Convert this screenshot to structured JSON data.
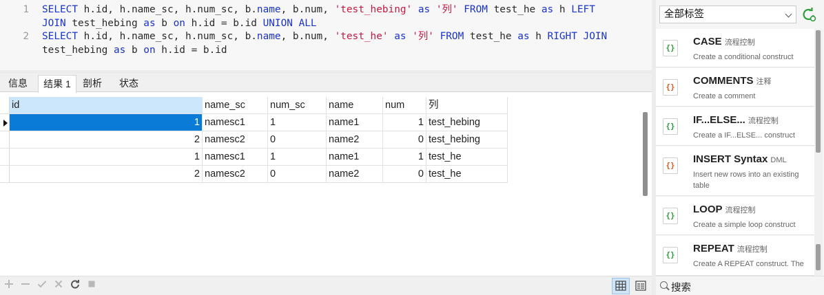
{
  "editor": {
    "lines": [
      {
        "number": "1",
        "tokens": [
          {
            "t": "SELECT ",
            "c": "kw"
          },
          {
            "t": "h.id, h.name_sc, h.num_sc, b.",
            "c": "id"
          },
          {
            "t": "name",
            "c": "kw"
          },
          {
            "t": ", b.num, ",
            "c": "id"
          },
          {
            "t": "'test_hebing'",
            "c": "str"
          },
          {
            "t": " as ",
            "c": "kw"
          },
          {
            "t": "'列'",
            "c": "str"
          },
          {
            "t": " FROM ",
            "c": "kw"
          },
          {
            "t": "test_he ",
            "c": "id"
          },
          {
            "t": "as",
            "c": "kw"
          },
          {
            "t": " h ",
            "c": "id"
          },
          {
            "t": "LEFT",
            "c": "kw"
          }
        ]
      },
      {
        "number": "",
        "tokens": [
          {
            "t": "JOIN",
            "c": "kw"
          },
          {
            "t": " test_hebing ",
            "c": "id"
          },
          {
            "t": "as",
            "c": "kw"
          },
          {
            "t": " b ",
            "c": "id"
          },
          {
            "t": "on",
            "c": "kw"
          },
          {
            "t": " h.id = b.id ",
            "c": "id"
          },
          {
            "t": "UNION ALL",
            "c": "kw"
          }
        ]
      },
      {
        "number": "2",
        "tokens": [
          {
            "t": "SELECT ",
            "c": "kw"
          },
          {
            "t": "h.id, h.name_sc, h.num_sc, b.",
            "c": "id"
          },
          {
            "t": "name",
            "c": "kw"
          },
          {
            "t": ", b.num, ",
            "c": "id"
          },
          {
            "t": "'test_he'",
            "c": "str"
          },
          {
            "t": " as ",
            "c": "kw"
          },
          {
            "t": "'列'",
            "c": "str"
          },
          {
            "t": " FROM ",
            "c": "kw"
          },
          {
            "t": "test_he ",
            "c": "id"
          },
          {
            "t": "as",
            "c": "kw"
          },
          {
            "t": " h ",
            "c": "id"
          },
          {
            "t": "RIGHT JOIN",
            "c": "kw"
          }
        ]
      },
      {
        "number": "",
        "tokens": [
          {
            "t": "test_hebing ",
            "c": "id"
          },
          {
            "t": "as",
            "c": "kw"
          },
          {
            "t": " b ",
            "c": "id"
          },
          {
            "t": "on",
            "c": "kw"
          },
          {
            "t": " h.id = b.id",
            "c": "id"
          }
        ]
      }
    ]
  },
  "tabs": [
    {
      "label": "信息",
      "active": false
    },
    {
      "label": "结果 1",
      "active": true
    },
    {
      "label": "剖析",
      "active": false
    },
    {
      "label": "状态",
      "active": false
    }
  ],
  "grid": {
    "columns": [
      "id",
      "name_sc",
      "num_sc",
      "name",
      "num",
      "列"
    ],
    "rows": [
      [
        "1",
        "namesc1",
        "1",
        "name1",
        "1",
        "test_hebing"
      ],
      [
        "2",
        "namesc2",
        "0",
        "name2",
        "0",
        "test_hebing"
      ],
      [
        "1",
        "namesc1",
        "1",
        "name1",
        "1",
        "test_he"
      ],
      [
        "2",
        "namesc2",
        "0",
        "name2",
        "0",
        "test_he"
      ]
    ],
    "selected_row": 0
  },
  "toolbar": {
    "add_icon": "plus-icon",
    "remove_icon": "minus-icon",
    "apply_icon": "check-icon",
    "discard_icon": "x-icon",
    "refresh_icon": "refresh-icon",
    "stop_icon": "stop-icon",
    "grid_view_icon": "grid-view-icon",
    "form_view_icon": "form-view-icon"
  },
  "panel": {
    "tag_select": "全部标签",
    "search_label": "搜索",
    "snippets": [
      {
        "title": "CASE",
        "tag": "流程控制",
        "desc": "Create a conditional construct",
        "icon_color": "#2e9d3c"
      },
      {
        "title": "COMMENTS",
        "tag": "注释",
        "desc": "Create a comment",
        "icon_color": "#e05a1f"
      },
      {
        "title": "IF...ELSE...",
        "tag": "流程控制",
        "desc": "Create a IF...ELSE... construct",
        "icon_color": "#2e9d3c"
      },
      {
        "title": "INSERT Syntax",
        "tag": "DML",
        "desc": "Insert new rows into an existing table",
        "icon_color": "#e05a1f"
      },
      {
        "title": "LOOP",
        "tag": "流程控制",
        "desc": "Create a simple loop construct",
        "icon_color": "#2e9d3c"
      },
      {
        "title": "REPEAT",
        "tag": "流程控制",
        "desc": "Create A REPEAT construct. The",
        "icon_color": "#2e9d3c"
      }
    ]
  },
  "colors": {
    "keyword": "#1a33cc",
    "string": "#c41a41",
    "selection": "#0a7bd6",
    "header_selected": "#cce6fb"
  }
}
